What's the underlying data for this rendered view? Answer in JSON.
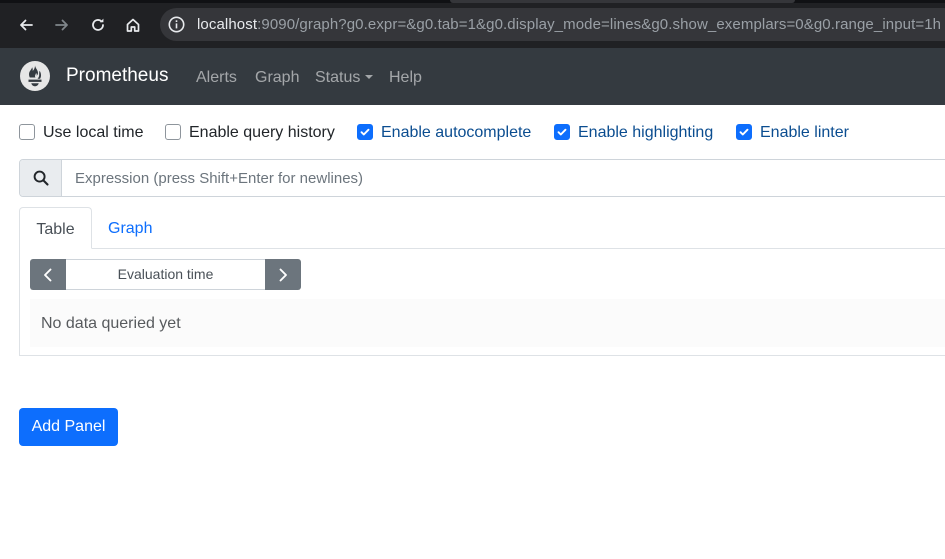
{
  "browser": {
    "url_host": "localhost",
    "url_rest": ":9090/graph?g0.expr=&g0.tab=1&g0.display_mode=lines&g0.show_exemplars=0&g0.range_input=1h",
    "icons": [
      "back-arrow-icon",
      "forward-arrow-icon",
      "reload-icon",
      "home-icon",
      "site-info-icon"
    ]
  },
  "navbar": {
    "brand": "Prometheus",
    "links": [
      {
        "label": "Alerts"
      },
      {
        "label": "Graph"
      },
      {
        "label": "Status"
      },
      {
        "label": "Help"
      }
    ],
    "background": "#343a40"
  },
  "options": [
    {
      "label": "Use local time",
      "checked": false
    },
    {
      "label": "Enable query history",
      "checked": false
    },
    {
      "label": "Enable autocomplete",
      "checked": true
    },
    {
      "label": "Enable highlighting",
      "checked": true
    },
    {
      "label": "Enable linter",
      "checked": true
    }
  ],
  "expression": {
    "placeholder": "Expression (press Shift+Enter for newlines)",
    "value": ""
  },
  "tabs": [
    {
      "label": "Table",
      "active": true
    },
    {
      "label": "Graph",
      "active": false
    }
  ],
  "table_panel": {
    "eval_time_placeholder": "Evaluation time",
    "empty_message": "No data queried yet"
  },
  "add_panel_label": "Add Panel",
  "colors": {
    "accent": "#0d6efd",
    "secondary": "#6c757d"
  }
}
